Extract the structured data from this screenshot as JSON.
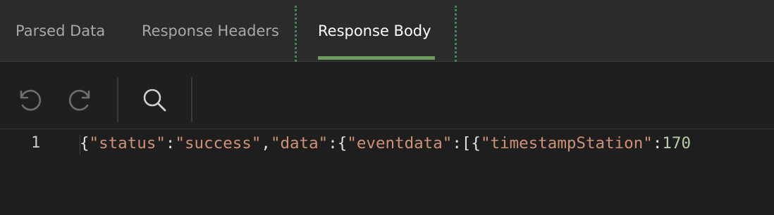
{
  "tabs": [
    {
      "label": "Parsed Data",
      "active": false
    },
    {
      "label": "Response Headers",
      "active": false
    },
    {
      "label": "Response Body",
      "active": true
    }
  ],
  "toolbar": {
    "undo_icon": "undo-icon",
    "redo_icon": "redo-icon",
    "search_icon": "search-icon"
  },
  "editor": {
    "line_number": "1",
    "tokens": {
      "t1": "{",
      "t2": "\"status\"",
      "t3": ":",
      "t4": "\"success\"",
      "t5": ",",
      "t6": "\"data\"",
      "t7": ":{",
      "t8": "\"eventdata\"",
      "t9": ":[{",
      "t10": "\"timestampStation\"",
      "t11": ":",
      "t12": "170"
    }
  },
  "colors": {
    "accent_underline": "#6f9a5e",
    "string": "#ce9178",
    "number": "#b5cea8",
    "separator_dots": "#3d8a5a"
  }
}
